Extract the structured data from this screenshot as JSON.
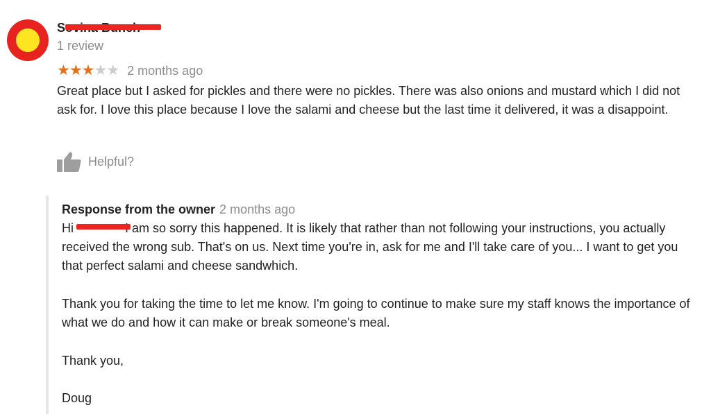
{
  "review": {
    "reviewer_name": "Sovina Bunch",
    "review_count": "1 review",
    "rating": 3,
    "rating_max": 5,
    "date": "2 months ago",
    "text": "Great place but I asked for pickles and there were no pickles. There was also onions and mustard which I did not ask for. I love this place because I love the salami and cheese but the last time it delivered, it was a disappoint.",
    "helpful_label": "Helpful?",
    "icons": {
      "avatar": "avatar-icon",
      "star": "star-icon",
      "helpful": "thumbs-up-icon"
    },
    "colors": {
      "star_filled": "#e7711b",
      "star_empty": "#cccccc",
      "avatar_outer": "#e8231f",
      "avatar_inner": "#ffe521",
      "redaction": "#ee2420"
    }
  },
  "owner_response": {
    "label": "Response from the owner",
    "date": "2 months ago",
    "greeting": "Hi",
    "paragraph_1_rest": "I am so sorry this happened. It is likely that rather than not following your instructions, you actually received the wrong sub. That's on us. Next time you're in, ask for me and I'll take care of you... I want to get you that perfect salami and cheese sandwhich.",
    "paragraph_2": "Thank you for taking the time to let me know. I'm going to continue to make sure my staff knows the importance of what we do and how it can make or break someone's meal.",
    "paragraph_3": "Thank you,",
    "signature": "Doug"
  }
}
